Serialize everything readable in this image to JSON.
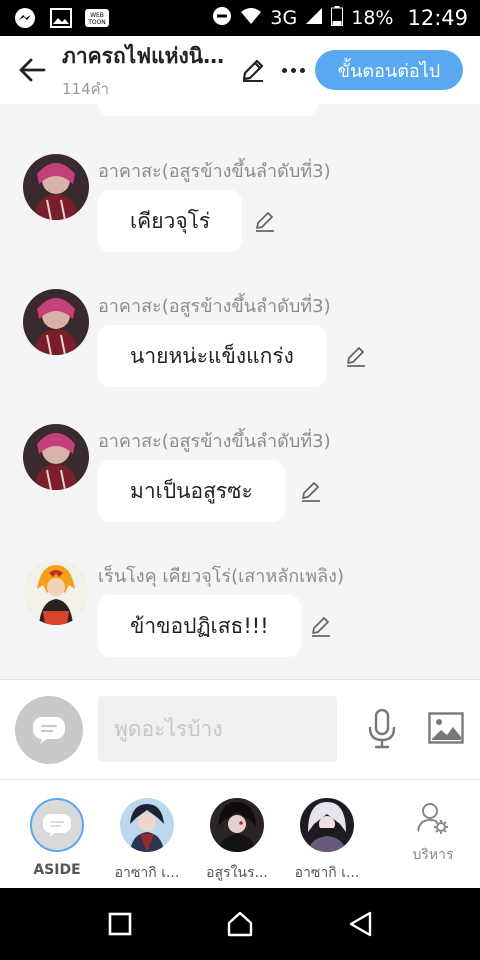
{
  "status": {
    "battery": "18%",
    "time": "12:49",
    "network": "3G",
    "app_icons": [
      "messenger-icon",
      "gallery-icon",
      "webtoon-icon"
    ]
  },
  "header": {
    "title": "ภาครถไฟแห่งนิรันดร์",
    "word_count": "114คำ",
    "next_button": "ขั้นตอนต่อไป"
  },
  "messages": [
    {
      "sender": "อาคาสะ(อสูรข้างขึ้นลำดับที่3)",
      "text": "เคียวจุโร่"
    },
    {
      "sender": "อาคาสะ(อสูรข้างขึ้นลำดับที่3)",
      "text": "นายหน่ะแข็งแกร่ง"
    },
    {
      "sender": "อาคาสะ(อสูรข้างขึ้นลำดับที่3)",
      "text": "มาเป็นอสูรซะ"
    },
    {
      "sender": "เร็นโงคุ เคียวจุโร่(เสาหลักเพลิง)",
      "text": "ข้าขอปฏิเสธ!!!"
    }
  ],
  "input": {
    "placeholder": "พูดอะไรบ้าง"
  },
  "characters": [
    {
      "label": "ASIDE"
    },
    {
      "label": "อาซากิ เ..."
    },
    {
      "label": "อสูรในร..."
    },
    {
      "label": "อาซากิ เ..."
    },
    {
      "label": "บริหาร"
    }
  ],
  "colors": {
    "accent": "#5aa9f0",
    "chat_bg": "#f5f5f5",
    "bubble": "#ffffff"
  }
}
